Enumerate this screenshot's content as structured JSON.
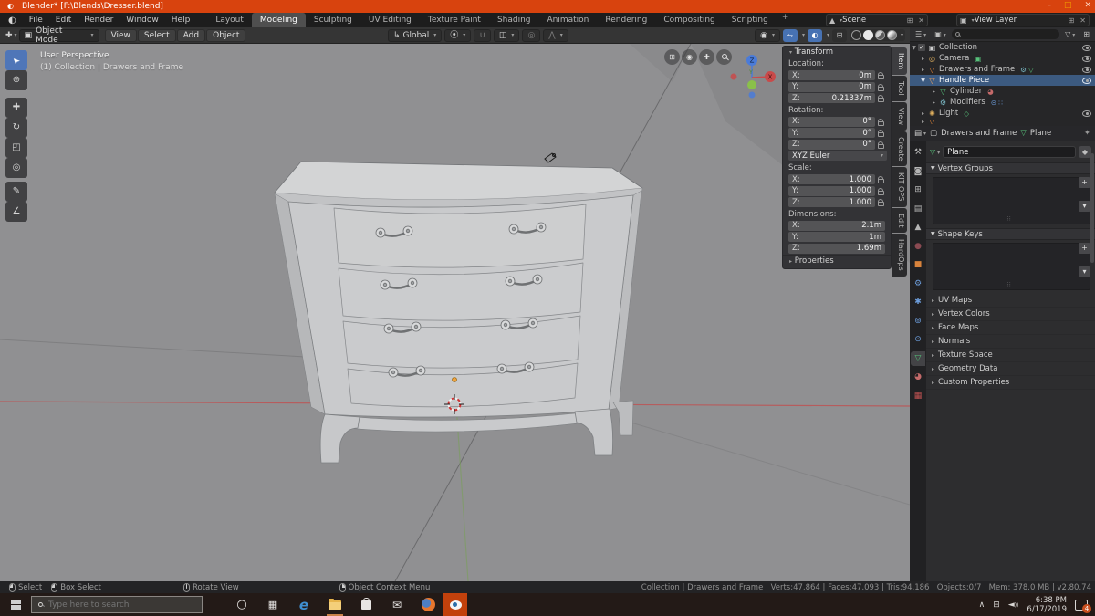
{
  "window": {
    "title": "Blender* [F:\\Blends\\Dresser.blend]"
  },
  "menubar": {
    "menus": [
      "File",
      "Edit",
      "Render",
      "Window",
      "Help"
    ],
    "workspaces": [
      "Layout",
      "Modeling",
      "Sculpting",
      "UV Editing",
      "Texture Paint",
      "Shading",
      "Animation",
      "Rendering",
      "Compositing",
      "Scripting"
    ],
    "active_workspace": "Modeling",
    "add_workspace": "+",
    "scene": "Scene",
    "view_layer": "View Layer"
  },
  "toolhdr": {
    "mode": "Object Mode",
    "menus": [
      "View",
      "Select",
      "Add",
      "Object"
    ],
    "orientation": "Global"
  },
  "viewport": {
    "perspective": "User Perspective",
    "context": "(1) Collection | Drawers and Frame",
    "gizmo": {
      "z": "Z",
      "y": "Y",
      "x": "X"
    }
  },
  "npanel": {
    "tabs": [
      "Item",
      "Tool",
      "View",
      "Create",
      "KIT OPS",
      "Edit",
      "HardOps"
    ],
    "active_tab": "Item",
    "transform_title": "Transform",
    "location_label": "Location:",
    "loc": [
      {
        "a": "X:",
        "v": "0m"
      },
      {
        "a": "Y:",
        "v": "0m"
      },
      {
        "a": "Z:",
        "v": "0.21337m"
      }
    ],
    "rotation_label": "Rotation:",
    "rot": [
      {
        "a": "X:",
        "v": "0°"
      },
      {
        "a": "Y:",
        "v": "0°"
      },
      {
        "a": "Z:",
        "v": "0°"
      }
    ],
    "euler": "XYZ Euler",
    "scale_label": "Scale:",
    "scale": [
      {
        "a": "X:",
        "v": "1.000"
      },
      {
        "a": "Y:",
        "v": "1.000"
      },
      {
        "a": "Z:",
        "v": "1.000"
      }
    ],
    "dims_label": "Dimensions:",
    "dims": [
      {
        "a": "X:",
        "v": "2.1m"
      },
      {
        "a": "Y:",
        "v": "1m"
      },
      {
        "a": "Z:",
        "v": "1.69m"
      }
    ],
    "properties_label": "Properties"
  },
  "outliner": {
    "rows": [
      {
        "label": "Collection",
        "icon": "collection-icon"
      },
      {
        "label": "Camera",
        "icon": "camera-icon"
      },
      {
        "label": "Drawers and Frame",
        "icon": "mesh-object-icon"
      },
      {
        "label": "Handle Piece",
        "icon": "mesh-object-icon",
        "selected": true
      },
      {
        "label": "Cylinder",
        "icon": "mesh-data-icon"
      },
      {
        "label": "Modifiers",
        "icon": "wrench-icon"
      },
      {
        "label": "Light",
        "icon": "light-icon"
      }
    ]
  },
  "props": {
    "breadcrumb_object": "Drawers and Frame",
    "breadcrumb_data": "Plane",
    "name_value": "Plane",
    "vertex_groups": "Vertex Groups",
    "shape_keys": "Shape Keys",
    "collapsed": [
      "UV Maps",
      "Vertex Colors",
      "Face Maps",
      "Normals",
      "Texture Space",
      "Geometry Data",
      "Custom Properties"
    ]
  },
  "statusbar": {
    "hints": [
      "Select",
      "Box Select",
      "Rotate View",
      "Object Context Menu"
    ],
    "stats": "Collection | Drawers and Frame | Verts:47,864 | Faces:47,093 | Tris:94,186 | Objects:0/7 | Mem: 378.0 MB | v2.80.74"
  },
  "taskbar": {
    "search_placeholder": "Type here to search",
    "time": "6:38 PM",
    "date": "6/17/2019",
    "notification_badge": "4"
  },
  "colors": {
    "titlebar": "#d8430e",
    "selection": "#3c5a80",
    "viewport_bg": "#909092",
    "blender_orange": "#c2410c"
  }
}
